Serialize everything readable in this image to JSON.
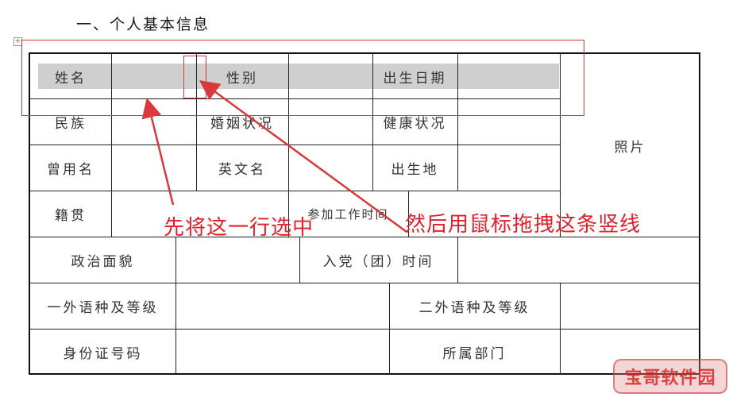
{
  "heading": "一、个人基本信息",
  "table": {
    "row1": {
      "name": "姓名",
      "gender": "性别",
      "birth_date": "出生日期"
    },
    "row2": {
      "ethnicity": "民族",
      "marital": "婚姻状况",
      "health": "健康状况"
    },
    "row3": {
      "former_name": "曾用名",
      "english_name": "英文名",
      "birthplace": "出生地"
    },
    "row4": {
      "native_place": "籍贯",
      "work_start": "参加工作时间"
    },
    "row5": {
      "political": "政治面貌",
      "party_join": "入党（团）时间"
    },
    "row6": {
      "lang1": "一外语种及等级",
      "lang2": "二外语种及等级"
    },
    "row7": {
      "id_number": "身份证号码",
      "department": "所属部门"
    },
    "photo": "照片"
  },
  "annotations": {
    "step1": "先将这一行选中",
    "step2": "然后用鼠标拖拽这条竖线",
    "color": "#e2202c"
  },
  "watermark": "宝哥软件园",
  "table_handle": "+"
}
